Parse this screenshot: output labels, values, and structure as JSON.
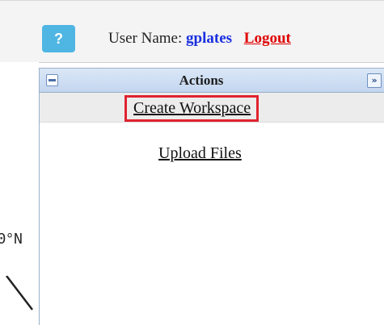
{
  "header": {
    "help_label": "?",
    "user_prefix": "User Name:",
    "username": "gplates",
    "logout_label": "Logout"
  },
  "map": {
    "lat_label": "0°N"
  },
  "panel": {
    "title": "Actions",
    "expand_label": "»",
    "actions": [
      {
        "label": "Create Workspace",
        "highlighted": true
      },
      {
        "label": "Upload Files",
        "highlighted": false
      }
    ]
  },
  "colors": {
    "help_button": "#4fb6e3",
    "username": "#1a2fe0",
    "logout": "#e00000",
    "highlight_border": "#e0222f",
    "panel_header": "#c3d6ef"
  }
}
